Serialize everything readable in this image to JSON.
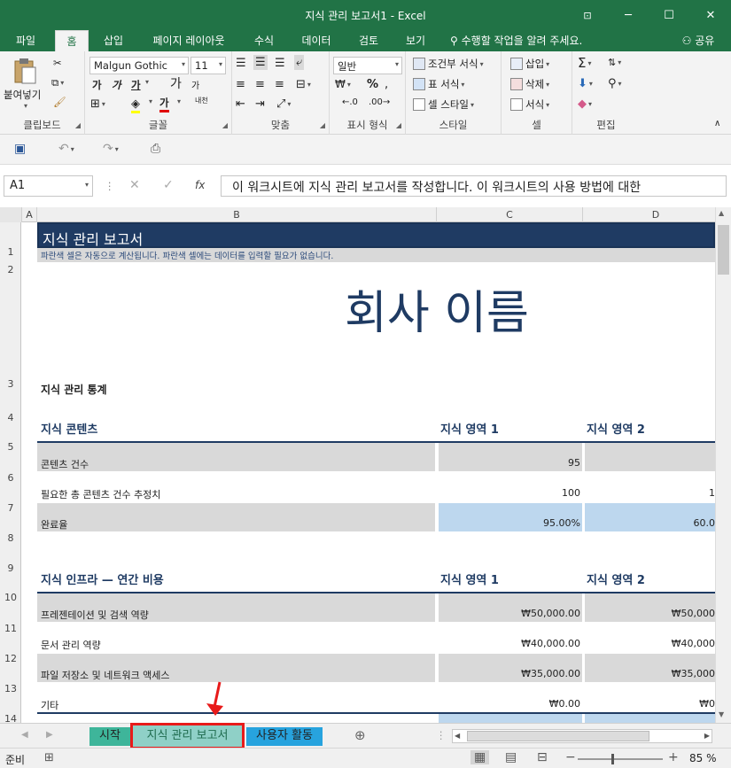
{
  "app": {
    "title": "지식 관리 보고서1 - Excel"
  },
  "tabs": [
    "파일",
    "홈",
    "삽입",
    "페이지 레이아웃",
    "수식",
    "데이터",
    "검토",
    "보기"
  ],
  "tell_me": "수행할 작업을 알려 주세요.",
  "share": "공유",
  "ribbon": {
    "clipboard": {
      "label": "클립보드",
      "paste": "붙여넣기"
    },
    "font": {
      "label": "글꼴",
      "name": "Malgun Gothic",
      "size": "11",
      "bold": "가",
      "italic": "가",
      "underline": "가",
      "grow": "가",
      "shrink": "가",
      "color_letter": "가",
      "phonetic": "내천"
    },
    "align": {
      "label": "맞춤"
    },
    "number": {
      "label": "표시 형식",
      "format": "일반"
    },
    "styles": {
      "label": "스타일",
      "cond": "조건부 서식",
      "table": "표 서식",
      "cell": "셀 스타일"
    },
    "cells": {
      "label": "셀",
      "insert": "삽입",
      "delete": "삭제",
      "format": "서식"
    },
    "editing": {
      "label": "편집"
    }
  },
  "namebox": "A1",
  "formula": "이 워크시트에 지식 관리 보고서를 작성합니다. 이 워크시트의 사용 방법에 대한",
  "columns": [
    "A",
    "B",
    "C",
    "D"
  ],
  "rows": [
    "1",
    "2",
    "3",
    "4",
    "5",
    "6",
    "7",
    "8",
    "9",
    "10",
    "11",
    "12",
    "13",
    "14"
  ],
  "sheet": {
    "title": "지식 관리 보고서",
    "note": "파란색 셀은 자동으로 계산됩니다. 파란색 셀에는 데이터를 입력할 필요가 없습니다.",
    "company": "회사 이름",
    "stats_heading": "지식 관리 통계",
    "content_heading": "지식 콘텐츠",
    "area1": "지식 영역 1",
    "area2": "지식 영역 2",
    "r6": {
      "label": "콘텐츠 건수",
      "c": "95",
      "d": ""
    },
    "r7": {
      "label": "필요한 총 콘텐츠 건수 추정치",
      "c": "100",
      "d": "1"
    },
    "r8": {
      "label": "완료율",
      "c": "95.00%",
      "d": "60.0"
    },
    "infra_heading": "지식 인프라 — 연간 비용",
    "r11": {
      "label": "프레젠테이션 및 검색 역량",
      "c": "₩50,000.00",
      "d": "₩50,000"
    },
    "r12": {
      "label": "문서 관리 역량",
      "c": "₩40,000.00",
      "d": "₩40,000"
    },
    "r13": {
      "label": "파일 저장소 및 네트워크 액세스",
      "c": "₩35,000.00",
      "d": "₩35,000"
    },
    "r14": {
      "label": "기타",
      "c": "₩0.00",
      "d": "₩0"
    }
  },
  "sheet_tabs": [
    "시작",
    "지식 관리 보고서",
    "사용자 활동"
  ],
  "status": {
    "ready": "준비",
    "zoom": "85 %"
  },
  "colors": {
    "excel_green": "#217346",
    "title_fill": "#1f3b63",
    "company_text": "#1f3b63",
    "gray_fill": "#d9d9d9",
    "blue_fill": "#bdd7ee",
    "highlight": "#e81a1a",
    "tab_start": "#3eb59a",
    "tab_active": "#8fd0c7",
    "tab_users": "#27a3de"
  }
}
